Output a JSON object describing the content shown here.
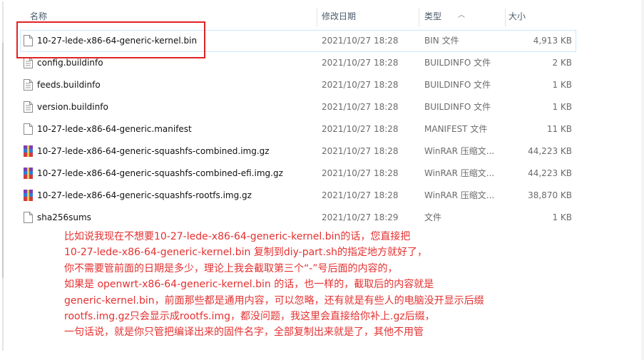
{
  "columns": {
    "name": "名称",
    "date": "修改日期",
    "type": "类型",
    "size": "大小"
  },
  "files": [
    {
      "name": "10-27-lede-x86-64-generic-kernel.bin",
      "date": "2021/10/27 18:28",
      "type": "BIN 文件",
      "size": "4,913 KB",
      "icon": "file-icon",
      "selected": true
    },
    {
      "name": "config.buildinfo",
      "date": "2021/10/27 18:28",
      "type": "BUILDINFO 文件",
      "size": "2 KB",
      "icon": "text-file-icon"
    },
    {
      "name": "feeds.buildinfo",
      "date": "2021/10/27 18:28",
      "type": "BUILDINFO 文件",
      "size": "1 KB",
      "icon": "text-file-icon"
    },
    {
      "name": "version.buildinfo",
      "date": "2021/10/27 18:28",
      "type": "BUILDINFO 文件",
      "size": "1 KB",
      "icon": "text-file-icon"
    },
    {
      "name": "10-27-lede-x86-64-generic.manifest",
      "date": "2021/10/27 18:28",
      "type": "MANIFEST 文件",
      "size": "11 KB",
      "icon": "file-icon"
    },
    {
      "name": "10-27-lede-x86-64-generic-squashfs-combined.img.gz",
      "date": "2021/10/27 18:28",
      "type": "WinRAR 压缩文...",
      "size": "44,223 KB",
      "icon": "winrar-archive-icon"
    },
    {
      "name": "10-27-lede-x86-64-generic-squashfs-combined-efi.img.gz",
      "date": "2021/10/27 18:28",
      "type": "WinRAR 压缩文...",
      "size": "44,223 KB",
      "icon": "winrar-archive-icon"
    },
    {
      "name": "10-27-lede-x86-64-generic-squashfs-rootfs.img.gz",
      "date": "2021/10/27 18:28",
      "type": "WinRAR 压缩文...",
      "size": "38,870 KB",
      "icon": "winrar-archive-icon"
    },
    {
      "name": "sha256sums",
      "date": "2021/10/27 18:29",
      "type": "文件",
      "size": "1 KB",
      "icon": "file-icon"
    }
  ],
  "annotation": [
    "比如说我现在不想要10-27-lede-x86-64-generic-kernel.bin的话，您直接把",
    "10-27-lede-x86-64-generic-kernel.bin 复制到diy-part.sh的指定地方就好了，",
    "你不需要管前面的日期是多少，理论上我会截取第三个“-”号后面的内容的，",
    "如果是 openwrt-x86-64-generic-kernel.bin 的话，也一样的，截取后的内容就是",
    "generic-kernel.bin，前面那些都是通用内容，可以忽略，还有就是有些人的电脑没开显示后缀",
    "rootfs.img.gz只会显示成rootfs.img，都没问题，我这里会直接给你补上.gz后缀，",
    "一句话说，就是你只管把编译出来的固件名字，全部复制出来就是了，其他不用管"
  ],
  "colors": {
    "highlight_box": "#e22222",
    "annotation_text": "#e53030",
    "selection_border": "#cce8ff"
  }
}
